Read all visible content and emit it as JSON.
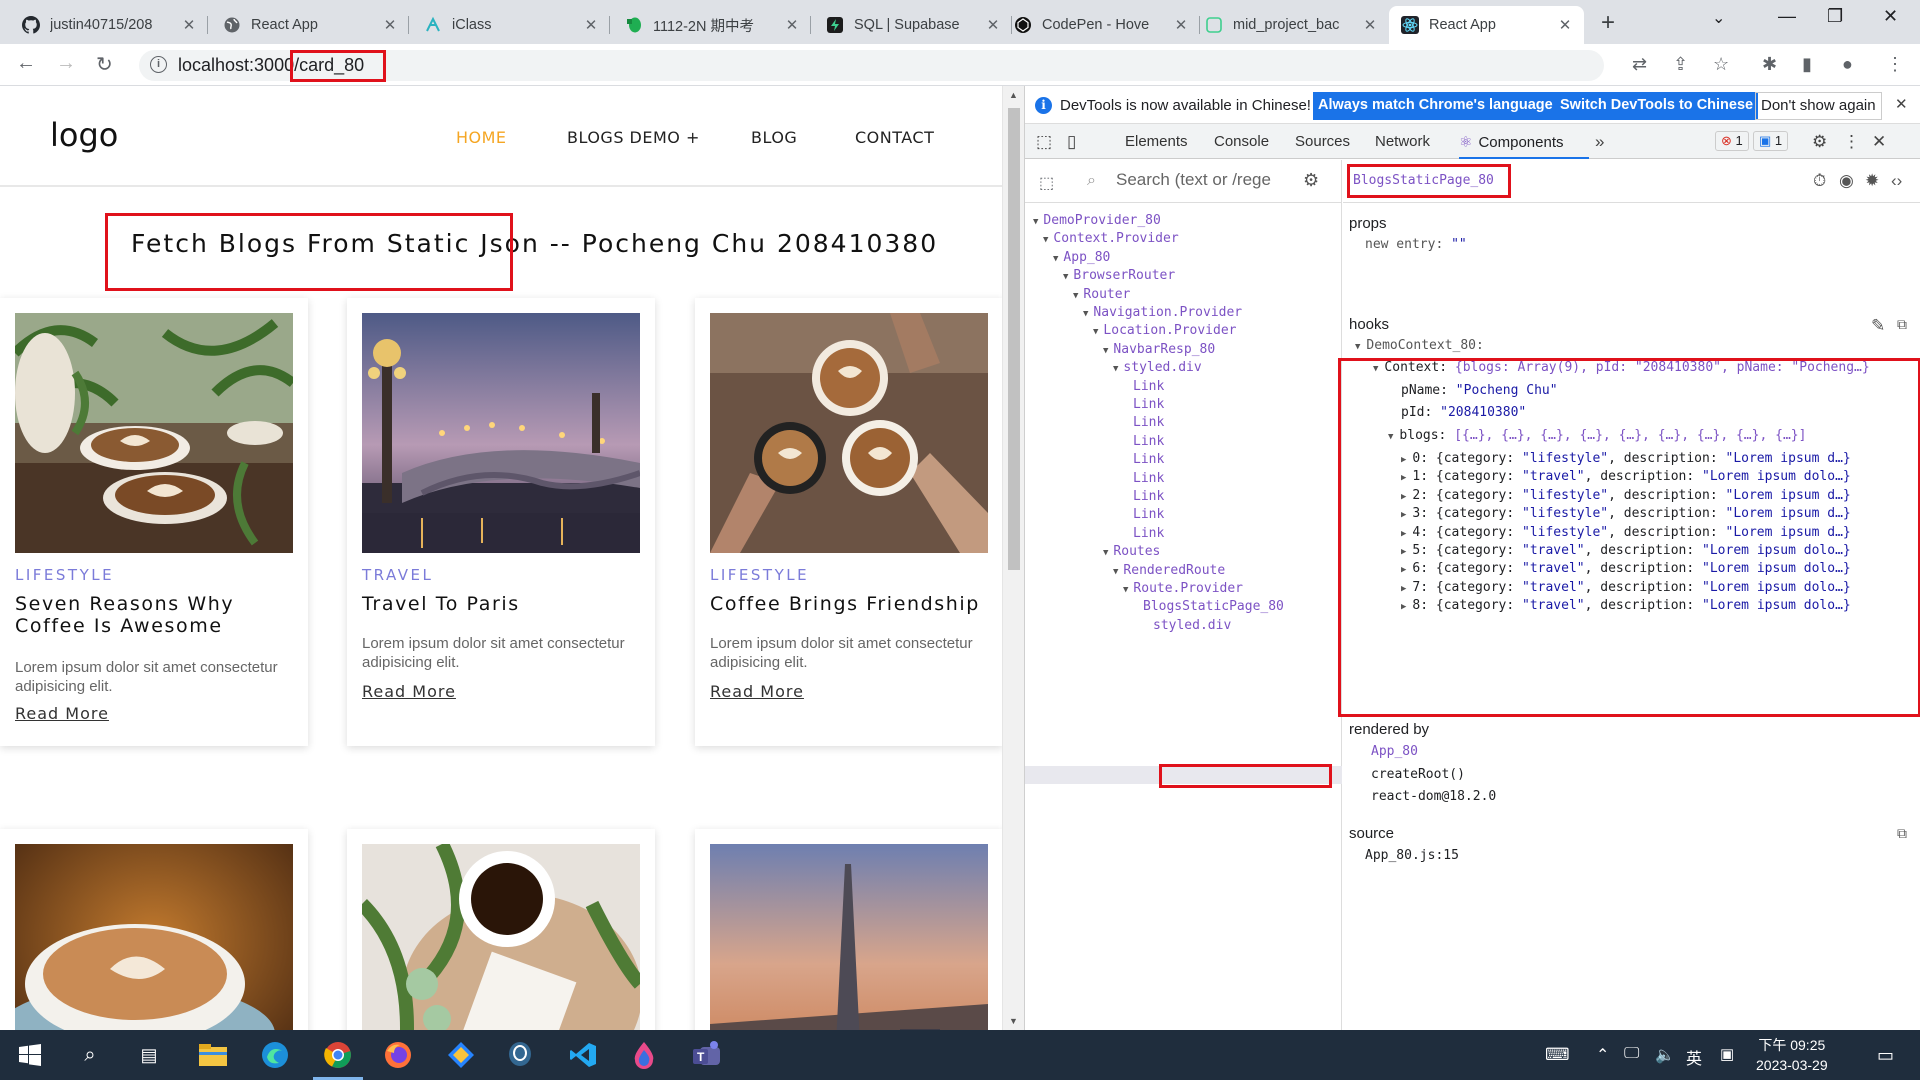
{
  "browser": {
    "tabs": [
      {
        "title": "justin40715/208",
        "icon": "github-icon"
      },
      {
        "title": "React App",
        "icon": "globe-icon"
      },
      {
        "title": "iClass",
        "icon": "iclass-icon"
      },
      {
        "title": "1112-2N 期中考",
        "icon": "evernote-icon"
      },
      {
        "title": "SQL | Supabase",
        "icon": "supabase-icon"
      },
      {
        "title": "CodePen - Hove",
        "icon": "codepen-icon"
      },
      {
        "title": "mid_project_bac",
        "icon": "supabase-icon"
      },
      {
        "title": "React App",
        "icon": "react-icon",
        "active": true
      }
    ],
    "url_host": "localhost:3000",
    "url_path": "/card_80"
  },
  "page": {
    "logo": "logo",
    "menu": [
      "HOME",
      "BLOGS DEMO +",
      "BLOG",
      "CONTACT"
    ],
    "heading": "Fetch Blogs From Static Json -- Pocheng Chu 208410380",
    "cards": [
      {
        "category": "LIFESTYLE",
        "title": "Seven Reasons Why Coffee Is Awesome",
        "desc": "Lorem ipsum dolor sit amet consectetur adipisicing elit.",
        "more": "Read More"
      },
      {
        "category": "TRAVEL",
        "title": "Travel To Paris",
        "desc": "Lorem ipsum dolor sit amet consectetur adipisicing elit.",
        "more": "Read More"
      },
      {
        "category": "LIFESTYLE",
        "title": "Coffee Brings Friendship",
        "desc": "Lorem ipsum dolor sit amet consectetur adipisicing elit.",
        "more": "Read More"
      }
    ]
  },
  "devtools": {
    "info_msg": "DevTools is now available in Chinese!",
    "btn_match": "Always match Chrome's language",
    "btn_switch": "Switch DevTools to Chinese",
    "btn_dismiss": "Don't show again",
    "tabs": [
      "Elements",
      "Console",
      "Sources",
      "Network",
      "Components"
    ],
    "error_count": "1",
    "msg_count": "1",
    "search_placeholder": "Search (text or /rege",
    "tree": [
      {
        "label": "DemoProvider_80",
        "arrow": "▼"
      },
      {
        "label": "Context.Provider",
        "arrow": "▼"
      },
      {
        "label": "App_80",
        "arrow": "▼"
      },
      {
        "label": "BrowserRouter",
        "arrow": "▼"
      },
      {
        "label": "Router",
        "arrow": "▼"
      },
      {
        "label": "Navigation.Provider",
        "arrow": "▼"
      },
      {
        "label": "Location.Provider",
        "arrow": "▼"
      },
      {
        "label": "NavbarResp_80",
        "arrow": "▼"
      },
      {
        "label": "styled.div",
        "arrow": "▼"
      },
      {
        "label": "Link",
        "arrow": ""
      },
      {
        "label": "Link",
        "arrow": ""
      },
      {
        "label": "Link",
        "arrow": ""
      },
      {
        "label": "Link",
        "arrow": ""
      },
      {
        "label": "Link",
        "arrow": ""
      },
      {
        "label": "Link",
        "arrow": ""
      },
      {
        "label": "Link",
        "arrow": ""
      },
      {
        "label": "Link",
        "arrow": ""
      },
      {
        "label": "Link",
        "arrow": ""
      },
      {
        "label": "Routes",
        "arrow": "▼"
      },
      {
        "label": "RenderedRoute",
        "arrow": "▼"
      },
      {
        "label": "Route.Provider",
        "arrow": "▼"
      },
      {
        "label": "BlogsStaticPage_80",
        "arrow": ""
      },
      {
        "label": "styled.div",
        "arrow": ""
      }
    ],
    "selected_component": "BlogsStaticPage_80",
    "props_label": "props",
    "props_line_key": "new entry",
    "props_line_val": "\"\"",
    "hooks_label": "hooks",
    "hooks": {
      "context_name": "DemoContext_80:",
      "context_line": "{blogs: Array(9), pId: \"208410380\", pName: \"Pocheng…}",
      "pName": "\"Pocheng Chu\"",
      "pId": "\"208410380\"",
      "blogs_line": "[{…}, {…}, {…}, {…}, {…}, {…}, {…}, {…}, {…}]",
      "items": [
        {
          "idx": "0",
          "cat": "\"lifestyle\"",
          "desc": "\"Lorem ipsum d…}"
        },
        {
          "idx": "1",
          "cat": "\"travel\"",
          "desc": "\"Lorem ipsum dolo…}"
        },
        {
          "idx": "2",
          "cat": "\"lifestyle\"",
          "desc": "\"Lorem ipsum d…}"
        },
        {
          "idx": "3",
          "cat": "\"lifestyle\"",
          "desc": "\"Lorem ipsum d…}"
        },
        {
          "idx": "4",
          "cat": "\"lifestyle\"",
          "desc": "\"Lorem ipsum d…}"
        },
        {
          "idx": "5",
          "cat": "\"travel\"",
          "desc": "\"Lorem ipsum dolo…}"
        },
        {
          "idx": "6",
          "cat": "\"travel\"",
          "desc": "\"Lorem ipsum dolo…}"
        },
        {
          "idx": "7",
          "cat": "\"travel\"",
          "desc": "\"Lorem ipsum dolo…}"
        },
        {
          "idx": "8",
          "cat": "\"travel\"",
          "desc": "\"Lorem ipsum dolo…}"
        }
      ]
    },
    "rendered_by_label": "rendered by",
    "rendered_by": [
      "App_80",
      "createRoot()",
      "react-dom@18.2.0"
    ],
    "source_label": "source",
    "source_val": "App_80.js:15"
  },
  "taskbar": {
    "clock_time": "下午 09:25",
    "clock_date": "2023-03-29",
    "ime": "英"
  }
}
